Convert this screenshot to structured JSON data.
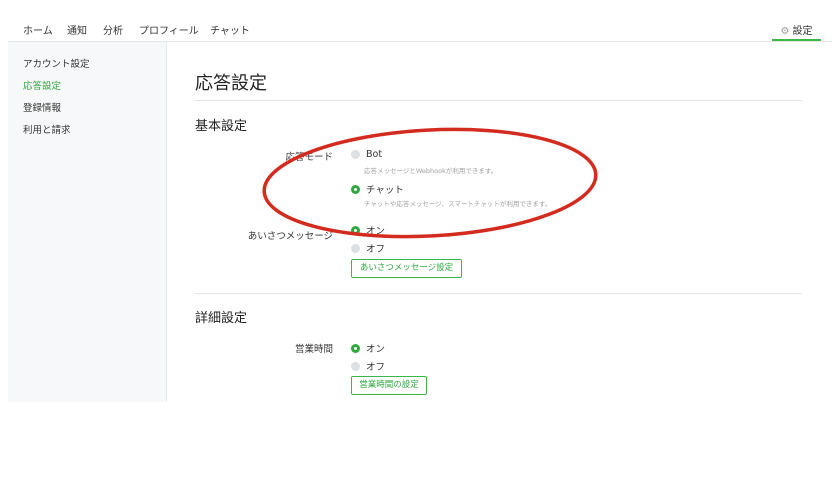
{
  "topnav": {
    "items": [
      "ホーム",
      "通知",
      "分析",
      "プロフィール",
      "チャット"
    ],
    "settings_label": "設定",
    "settings_icon": "gear-icon",
    "accent_color": "#3ab54a"
  },
  "sidebar": {
    "items": [
      {
        "label": "アカウント設定",
        "active": false
      },
      {
        "label": "応答設定",
        "active": true
      },
      {
        "label": "登録情報",
        "active": false
      },
      {
        "label": "利用と請求",
        "active": false
      }
    ]
  },
  "main": {
    "title": "応答設定",
    "basic": {
      "title": "基本設定",
      "response_mode": {
        "label": "応答モード",
        "options": [
          {
            "label": "Bot",
            "help": "応答メッセージとWebhookが利用できます。",
            "selected": false
          },
          {
            "label": "チャット",
            "help": "チャットや応答メッセージ、スマートチャットが利用できます。",
            "selected": true
          }
        ]
      },
      "greeting": {
        "label": "あいさつメッセージ",
        "options": [
          {
            "label": "オン",
            "selected": true
          },
          {
            "label": "オフ",
            "selected": false
          }
        ],
        "button": "あいさつメッセージ設定"
      }
    },
    "advanced": {
      "title": "詳細設定",
      "business_hours": {
        "label": "営業時間",
        "options": [
          {
            "label": "オン",
            "selected": true
          },
          {
            "label": "オフ",
            "selected": false
          }
        ],
        "button": "営業時間の設定"
      }
    }
  },
  "annotation_color": "#d42b1f"
}
